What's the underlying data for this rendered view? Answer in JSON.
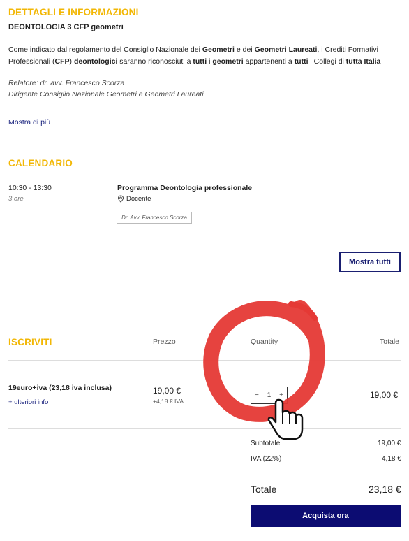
{
  "details": {
    "heading": "DETTAGLI E INFORMAZIONI",
    "course_title": "DEONTOLOGIA 3 CFP geometri",
    "desc": {
      "t1": "Come indicato dal regolamento del Consiglio Nazionale dei ",
      "b1": "Geometri",
      "t2": " e dei ",
      "b2": "Geometri Laureati",
      "t3": ", i Crediti Formativi Professionali (",
      "b3": "CFP",
      "t4": ") ",
      "b4": "deontologici",
      "t5": " saranno riconosciuti a ",
      "b5": "tutti",
      "t6": " i ",
      "b6": "geometri",
      "t7": " appartenenti a ",
      "b7": "tutti",
      "t8": " i Collegi di ",
      "b8": "tutta Italia"
    },
    "relatore_line1": "Relatore: dr. avv. Francesco Scorza",
    "relatore_line2": "Dirigente Consiglio Nazionale Geometri e Geometri Laureati",
    "show_more": "Mostra di più"
  },
  "calendar": {
    "heading": "CALENDARIO",
    "time": "10:30 - 13:30",
    "duration": "3 ore",
    "program": "Programma Deontologia professionale",
    "role": "Docente",
    "speaker_tag": "Dr. Avv. Francesco Scorza",
    "show_all": "Mostra tutti"
  },
  "signup": {
    "heading": "ISCRIVITI",
    "col_price": "Prezzo",
    "col_quantity": "Quantity",
    "col_total": "Totale",
    "item_name": "19euro+iva (23,18 iva inclusa)",
    "more_info": "+ ulteriori info",
    "price": "19,00 €",
    "vat_line": "+4,18 € IVA",
    "qty_minus": "−",
    "qty_value": "1",
    "qty_plus": "+",
    "row_total": "19,00 €",
    "subtotal_label": "Subtotale",
    "subtotal_value": "19,00 €",
    "iva_label": "IVA (22%)",
    "iva_value": "4,18 €",
    "total_label": "Totale",
    "total_value": "23,18 €",
    "buy_button": "Acquista ora"
  },
  "colors": {
    "accent_yellow": "#f2b705",
    "navy": "#0c0c72",
    "annotation_red": "#e53935"
  },
  "icons": [
    "location-pin-icon",
    "hand-cursor-icon",
    "red-circle-annotation"
  ]
}
